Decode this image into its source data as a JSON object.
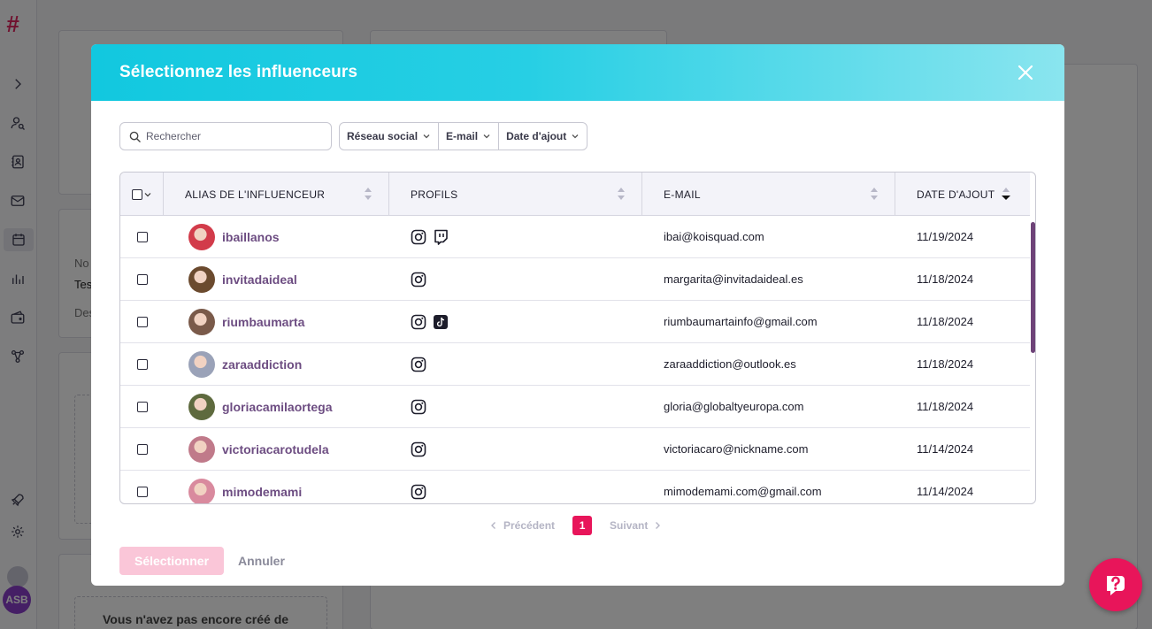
{
  "background": {
    "texts": [
      "No",
      "Tes",
      "Des"
    ],
    "empty_message": "Vous n'avez pas encore créé de",
    "user_initials": "ASB"
  },
  "modal": {
    "title": "Sélectionnez les influenceurs",
    "search_placeholder": "Rechercher",
    "filters": [
      {
        "label": "Réseau social"
      },
      {
        "label": "E-mail"
      },
      {
        "label": "Date d'ajout"
      }
    ],
    "table": {
      "headers": {
        "alias": "ALIAS DE L'INFLUENCEUR",
        "profils": "PROFILS",
        "email": "E-MAIL",
        "date": "DATE D'AJOUT"
      },
      "rows": [
        {
          "alias": "ibaillanos",
          "profiles": [
            "instagram",
            "twitch"
          ],
          "email": "ibai@koisquad.com",
          "date": "11/19/2024",
          "avatar_color": "#d23b4a"
        },
        {
          "alias": "invitadaideal",
          "profiles": [
            "instagram"
          ],
          "email": "margarita@invitadaideal.es",
          "date": "11/18/2024",
          "avatar_color": "#6b4a2e"
        },
        {
          "alias": "riumbaumarta",
          "profiles": [
            "instagram",
            "tiktok"
          ],
          "email": "riumbaumartainfo@gmail.com",
          "date": "11/18/2024",
          "avatar_color": "#7a5a4a"
        },
        {
          "alias": "zaraaddiction",
          "profiles": [
            "instagram"
          ],
          "email": "zaraaddiction@outlook.es",
          "date": "11/18/2024",
          "avatar_color": "#9aa2b8"
        },
        {
          "alias": "gloriacamilaortega",
          "profiles": [
            "instagram"
          ],
          "email": "gloria@globaltyeuropa.com",
          "date": "11/18/2024",
          "avatar_color": "#5e6a3e"
        },
        {
          "alias": "victoriacarotudela",
          "profiles": [
            "instagram"
          ],
          "email": "victoriacaro@nickname.com",
          "date": "11/14/2024",
          "avatar_color": "#c07a8a"
        },
        {
          "alias": "mimodemami",
          "profiles": [
            "instagram"
          ],
          "email": "mimodemami.com@gmail.com",
          "date": "11/14/2024",
          "avatar_color": "#d98a9e"
        }
      ]
    },
    "pagination": {
      "prev": "Précédent",
      "current": "1",
      "next": "Suivant"
    },
    "buttons": {
      "select": "Sélectionner",
      "cancel": "Annuler"
    }
  },
  "colors": {
    "accent": "#e8155a",
    "header_start": "#12c8df",
    "alias_text": "#6d4d82"
  },
  "icons": [
    "chevron-right-icon",
    "user-search-icon",
    "contacts-icon",
    "mail-icon",
    "calendar-icon",
    "chart-icon",
    "wallet-icon",
    "network-icon",
    "rocket-icon",
    "gear-icon",
    "help-icon",
    "close-icon",
    "search-icon"
  ]
}
